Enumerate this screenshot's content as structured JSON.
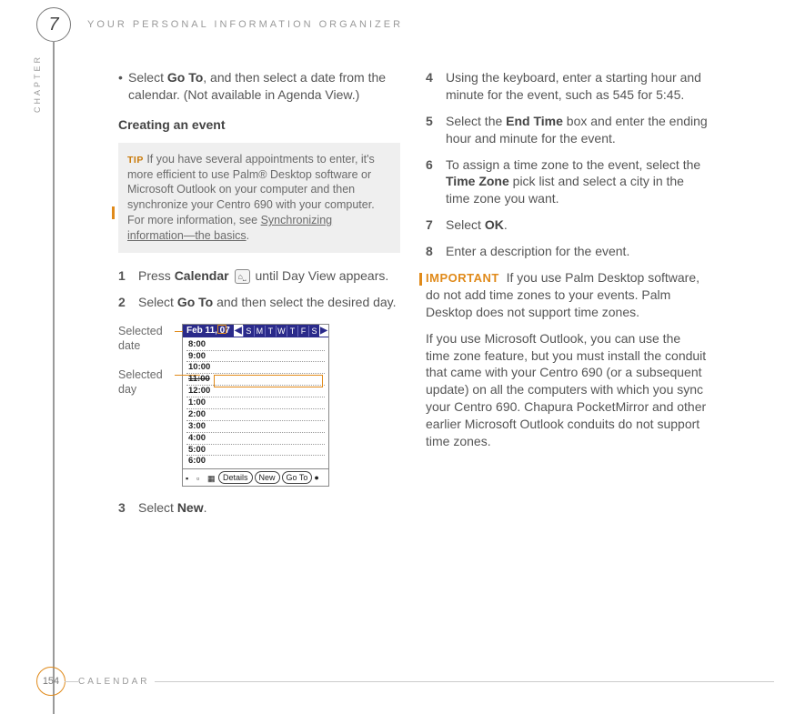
{
  "header": {
    "chapter_number": "7",
    "chapter_title": "YOUR PERSONAL INFORMATION ORGANIZER",
    "chapter_word": "CHAPTER"
  },
  "col1": {
    "bullet": {
      "pre": "Select ",
      "bold": "Go To",
      "post": ", and then select a date from the calendar. (Not available in Agenda View.)"
    },
    "heading": "Creating an event",
    "tip": {
      "label": "TIP",
      "text1": "If you have several appointments to enter, it's more efficient to use Palm",
      "reg": "®",
      "text2": " Desktop software or Microsoft Outlook on your computer and then synchronize your Centro 690 with your computer. For more information, see ",
      "link": "Synchronizing information—the basics",
      "period": "."
    },
    "steps": [
      {
        "n": "1",
        "pre": "Press ",
        "bold": "Calendar",
        "post": " until Day View appears."
      },
      {
        "n": "2",
        "pre": "Select ",
        "bold": "Go To",
        "post": " and then select the desired day."
      },
      {
        "n": "3",
        "pre": "Select ",
        "bold": "New",
        "post": "."
      }
    ],
    "figure": {
      "label1": "Selected date",
      "label2": "Selected day",
      "device": {
        "date": "Feb 11, 07",
        "days": [
          "S",
          "M",
          "T",
          "W",
          "T",
          "F",
          "S"
        ],
        "hours": [
          "8:00",
          "9:00",
          "10:00",
          "11:00",
          "12:00",
          "1:00",
          "2:00",
          "3:00",
          "4:00",
          "5:00",
          "6:00"
        ],
        "btn_details": "Details",
        "btn_new": "New",
        "btn_goto": "Go To"
      }
    }
  },
  "col2": {
    "steps": [
      {
        "n": "4",
        "text": "Using the keyboard, enter a starting hour and minute for the event, such as 545 for 5:45."
      },
      {
        "n": "5",
        "pre": "Select the ",
        "bold": "End Time",
        "post": " box and enter the ending hour and minute for the event."
      },
      {
        "n": "6",
        "pre": "To assign a time zone to the event, select the ",
        "bold": "Time Zone",
        "post": " pick list and select a city in the time zone you want."
      },
      {
        "n": "7",
        "pre": "Select ",
        "bold": "OK",
        "post": "."
      },
      {
        "n": "8",
        "text": "Enter a description for the event."
      }
    ],
    "important": {
      "label": "IMPORTANT",
      "text": "If you use Palm Desktop software, do not add time zones to your events. Palm Desktop does not support time zones."
    },
    "para": "If you use Microsoft Outlook, you can use the time zone feature, but you must install the conduit that came with your Centro 690 (or a subsequent update) on all the computers with which you sync your Centro 690. Chapura PocketMirror and other earlier Microsoft Outlook conduits do not support time zones."
  },
  "footer": {
    "page": "154",
    "section": "CALENDAR"
  }
}
